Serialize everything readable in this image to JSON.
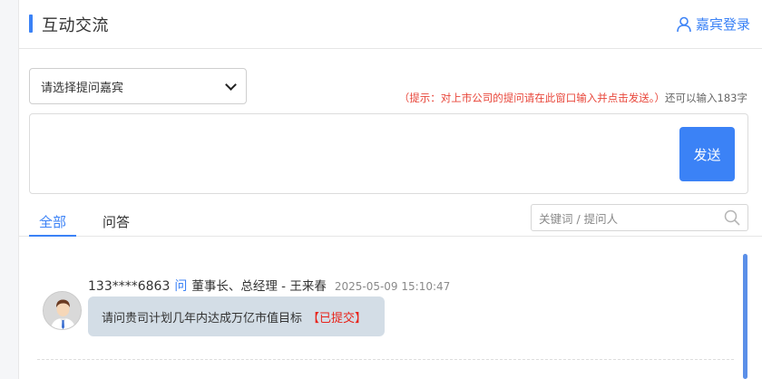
{
  "header": {
    "title": "互动交流",
    "guest_login_label": "嘉宾登录",
    "accent_color": "#3b82f6"
  },
  "form": {
    "guest_select": {
      "selected": "请选择提问嘉宾"
    },
    "hint": {
      "notice": "（提示：对上市公司的提问请在此窗口输入并点击发送。）",
      "remaining": "还可以输入183字"
    },
    "question_box": {
      "value": ""
    },
    "send_label": "发送"
  },
  "tabs": [
    {
      "label": "全部",
      "active": true
    },
    {
      "label": "问答",
      "active": false
    }
  ],
  "search": {
    "placeholder": "关键词 / 提问人"
  },
  "feed": [
    {
      "user": "133****6863",
      "ask_word": "问",
      "target": "董事长、总经理 - 王来春",
      "time": "2025-05-09 15:10:47",
      "question": "请问贵司计划几年内达成万亿市值目标",
      "status": "【已提交】",
      "status_color": "#e8231a"
    }
  ],
  "icons": {
    "guest_login": "user-icon",
    "search": "search-icon",
    "select": "chevron-down-icon",
    "avatar": "user-avatar-icon"
  }
}
